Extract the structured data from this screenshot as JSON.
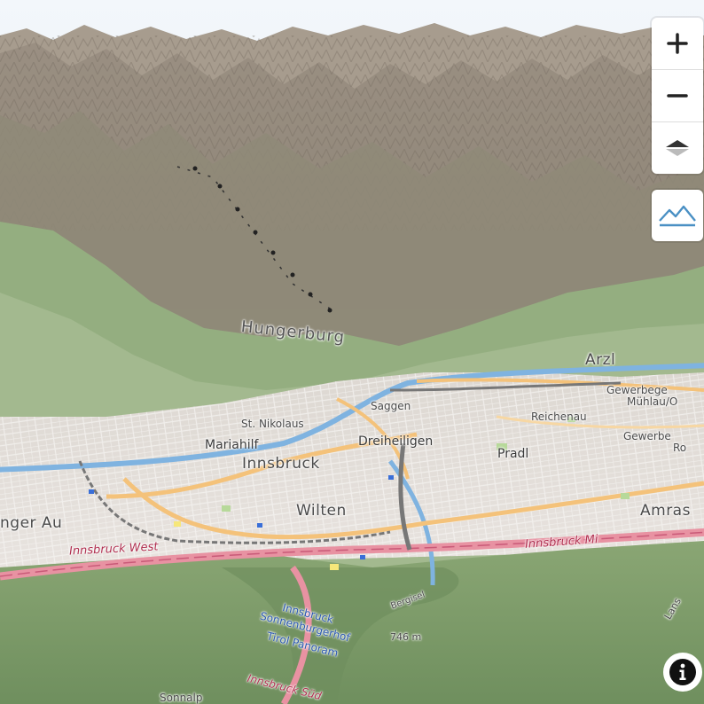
{
  "map": {
    "labels": {
      "hungerburg": "Hungerburg",
      "arzl": "Arzl",
      "gewerbegebiet_muhlau": "Gewerbege",
      "muhlau": "Mühlau/O",
      "saggen": "Saggen",
      "reichenau": "Reichenau",
      "st_nikolaus": "St. Nikolaus",
      "mariahilf": "Mariahilf",
      "dreiheiligen": "Dreiheiligen",
      "pradl": "Pradl",
      "gewerbe_rossau": "Gewerbe",
      "ro": "Ro",
      "innsbruck": "Innsbruck",
      "wilten": "Wilten",
      "amras": "Amras",
      "hoetting_west_au": "nger Au",
      "innsbruck_west": "Innsbruck West",
      "innsbruck_mitte": "Innsbruck Mi",
      "innsbruck_sonnenburgerhof": "Innsbruck",
      "sonnenburgerhof": "Sonnenburgerhof",
      "tirol_panorama": "Tirol Panoram",
      "bergisel": "Bergisel",
      "bergisel_elev": "746 m",
      "innsbruck_sud": "Innsbruck Süd",
      "sonnalpe": "Sonnalp",
      "lans": "Lans"
    }
  },
  "controls": {
    "zoom_in_icon": "plus-icon",
    "zoom_out_icon": "minus-icon",
    "compass_icon": "compass-icon",
    "terrain_icon": "mountain-terrain-icon",
    "info_icon": "info-icon"
  },
  "colors": {
    "terrain_light": "#bdb2a3",
    "terrain_dark": "#6f6559",
    "forest": "#8fae7a",
    "urban": "#e6e1de",
    "motorway": "#e892a2",
    "primary_road": "#f4c27a",
    "river": "#7fb3e0",
    "terrain_button": "#4a90c4"
  }
}
